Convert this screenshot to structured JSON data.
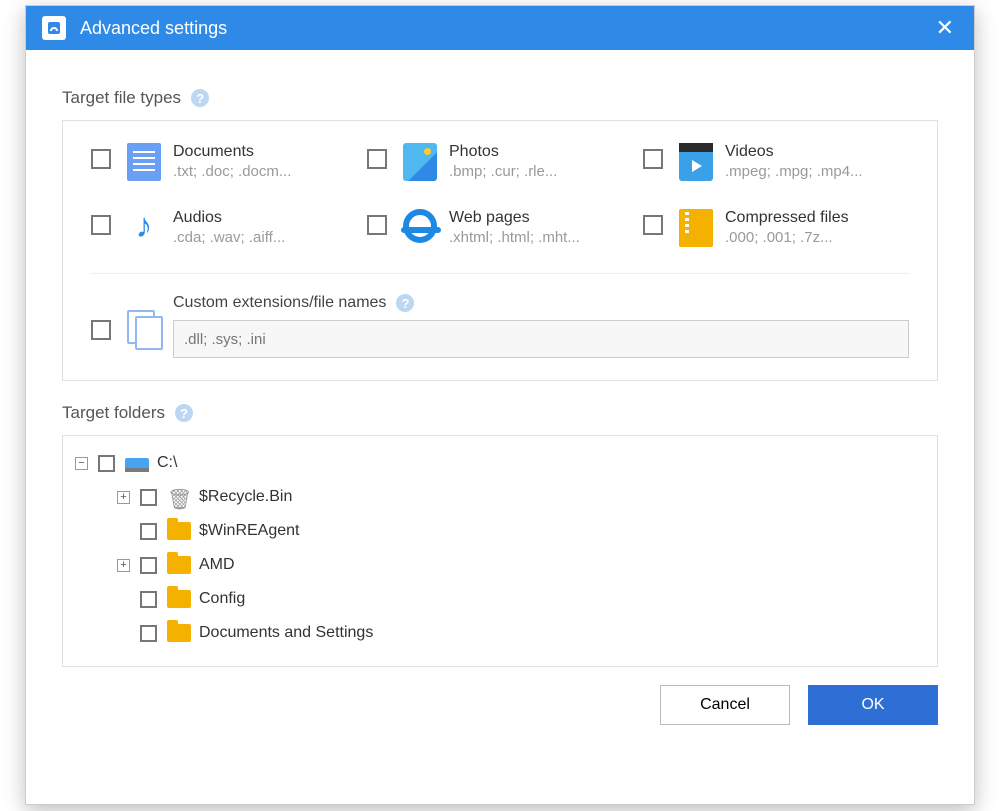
{
  "window": {
    "title": "Advanced settings"
  },
  "sections": {
    "file_types": "Target file types",
    "folders": "Target folders"
  },
  "file_types": {
    "documents": {
      "title": "Documents",
      "exts": ".txt; .doc; .docm..."
    },
    "photos": {
      "title": "Photos",
      "exts": ".bmp; .cur; .rle..."
    },
    "videos": {
      "title": "Videos",
      "exts": ".mpeg; .mpg; .mp4..."
    },
    "audios": {
      "title": "Audios",
      "exts": ".cda; .wav; .aiff..."
    },
    "webpages": {
      "title": "Web pages",
      "exts": ".xhtml; .html; .mht..."
    },
    "compressed": {
      "title": "Compressed files",
      "exts": ".000; .001; .7z..."
    }
  },
  "custom": {
    "label": "Custom extensions/file names",
    "placeholder": ".dll; .sys; .ini"
  },
  "tree": {
    "root": {
      "label": "C:\\"
    },
    "items": [
      {
        "label": "$Recycle.Bin",
        "expandable": true,
        "icon": "trash"
      },
      {
        "label": "$WinREAgent",
        "expandable": false,
        "icon": "folder"
      },
      {
        "label": "AMD",
        "expandable": true,
        "icon": "folder"
      },
      {
        "label": "Config",
        "expandable": false,
        "icon": "folder"
      },
      {
        "label": "Documents and Settings",
        "expandable": false,
        "icon": "folder"
      }
    ]
  },
  "buttons": {
    "cancel": "Cancel",
    "ok": "OK"
  }
}
